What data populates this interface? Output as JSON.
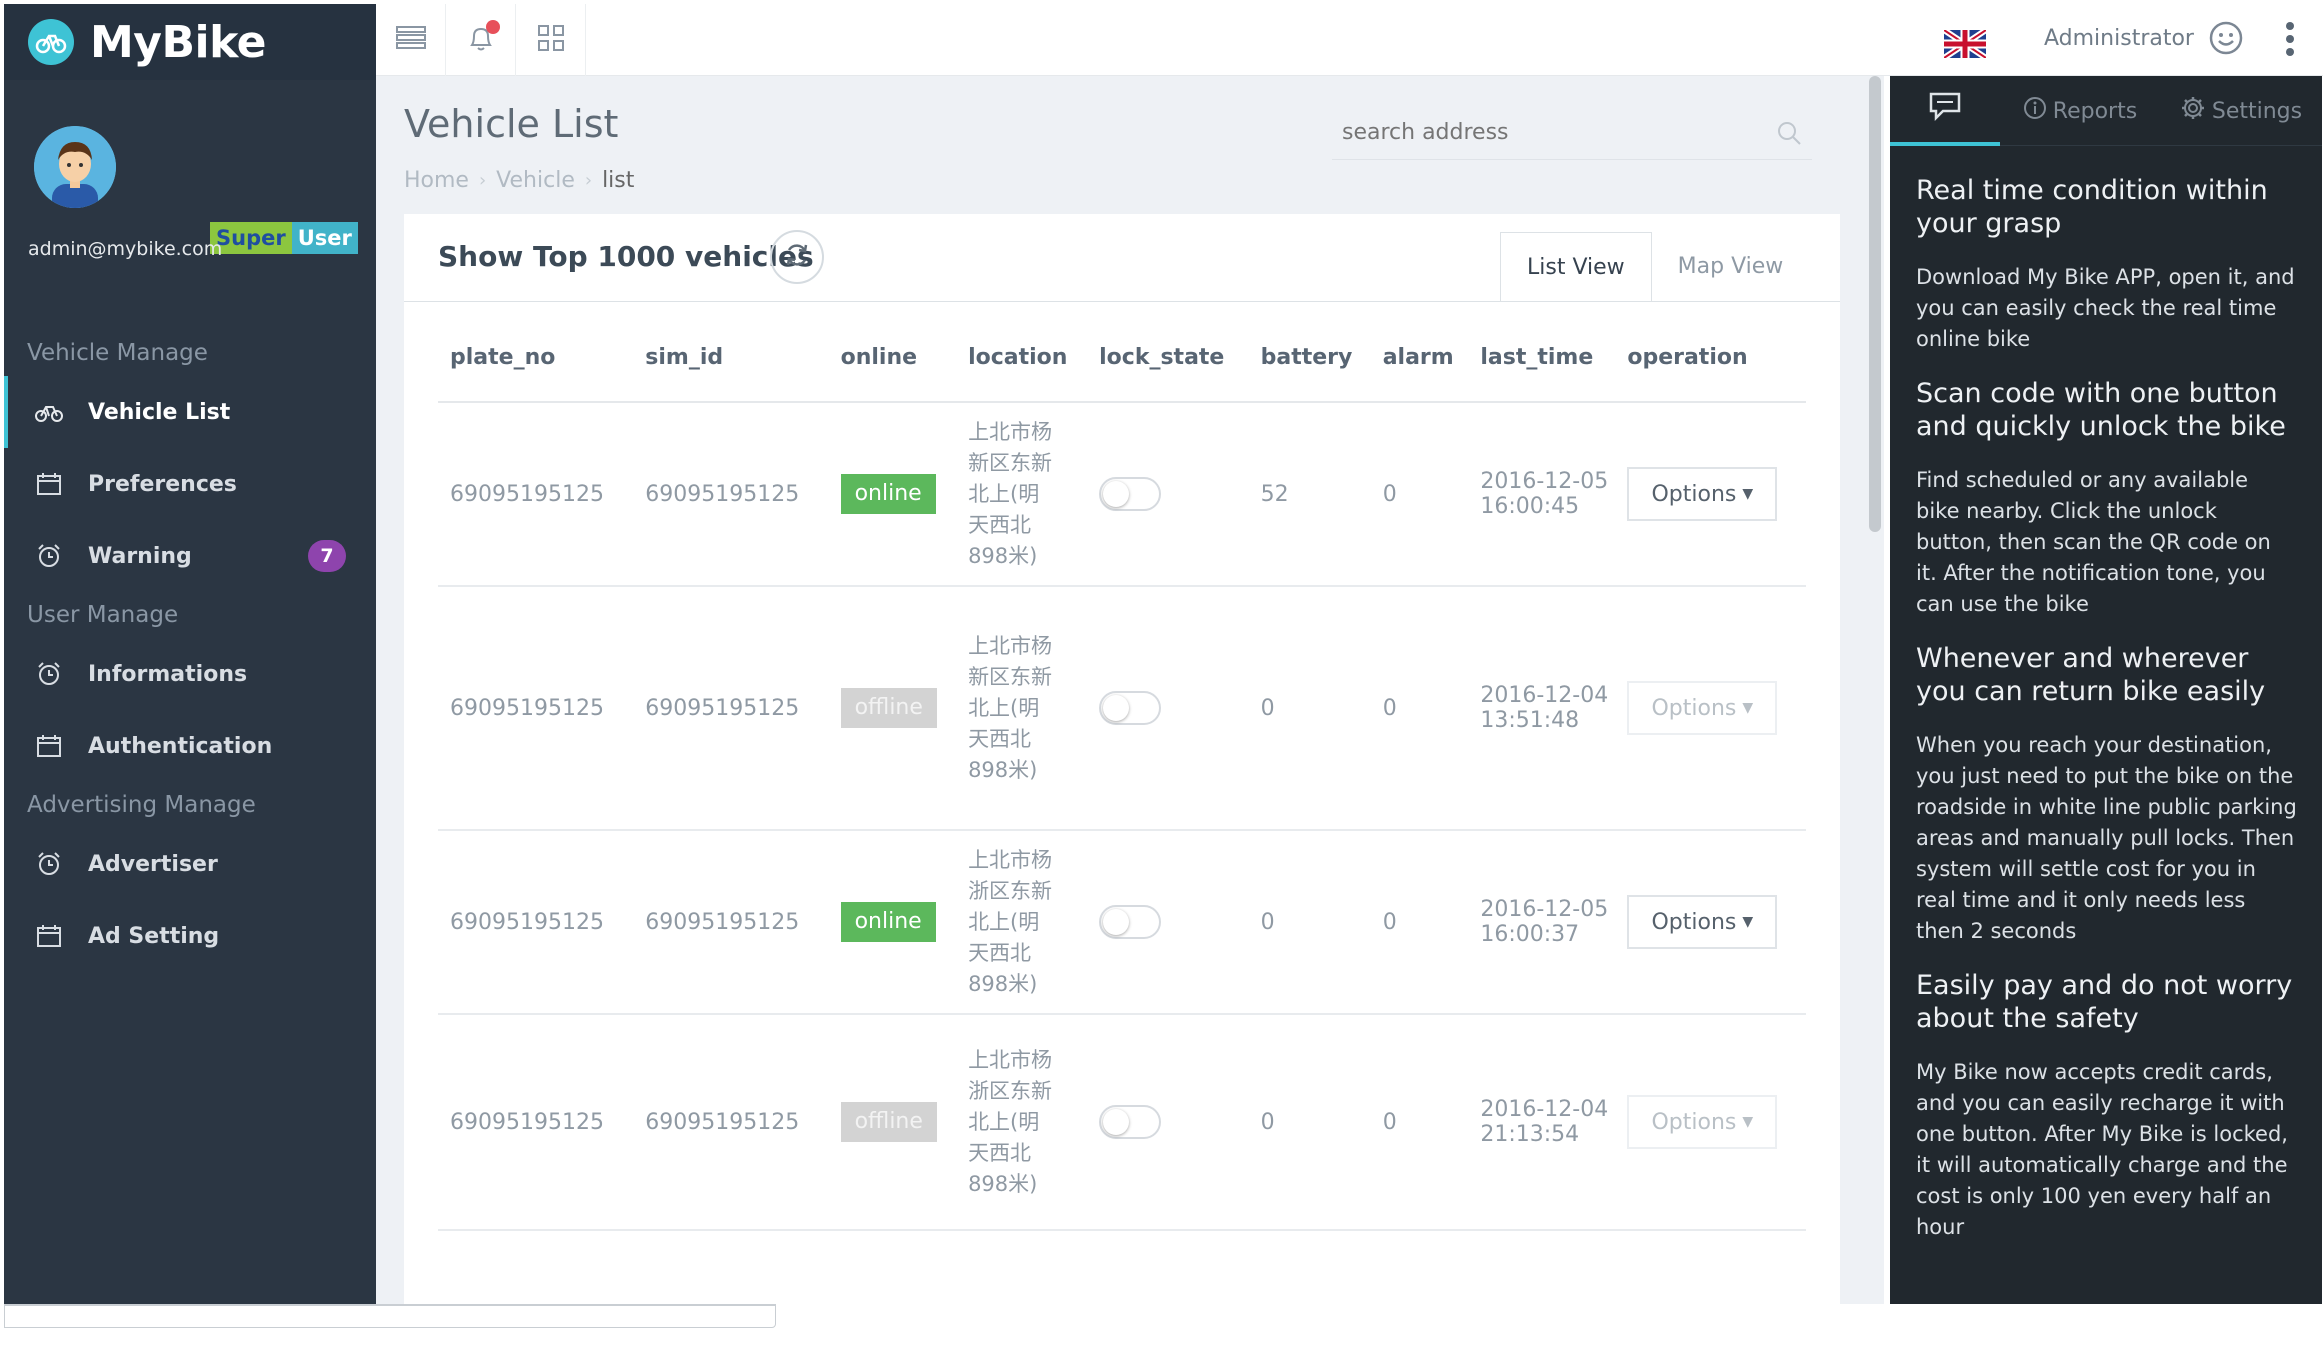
{
  "app": {
    "name": "MyBike"
  },
  "profile": {
    "role_part1": "Super",
    "role_part2": "User",
    "email": "admin@mybike.com"
  },
  "nav": {
    "group_vehicle": "Vehicle Manage",
    "group_user": "User Manage",
    "group_ads": "Advertising Manage",
    "items": [
      {
        "label": "Vehicle List"
      },
      {
        "label": "Preferences"
      },
      {
        "label": "Warning",
        "badge": "7"
      },
      {
        "label": "Informations"
      },
      {
        "label": "Authentication"
      },
      {
        "label": "Advertiser"
      },
      {
        "label": "Ad Setting"
      }
    ]
  },
  "topbar": {
    "user": "Administrator",
    "language_flag": "uk-flag-icon"
  },
  "page": {
    "title": "Vehicle List",
    "search_placeholder": "search address",
    "breadcrumb": [
      "Home",
      "Vehicle",
      "list"
    ]
  },
  "panel": {
    "title": "Show Top 1000 vehicles",
    "tab_list": "List View",
    "tab_map": "Map View"
  },
  "table": {
    "headers": [
      "plate_no",
      "sim_id",
      "online",
      "location",
      "lock_state",
      "battery",
      "alarm",
      "last_time",
      "operation"
    ],
    "option_label": "Options",
    "rows": [
      {
        "plate_no": "69095195125",
        "sim_id": "69095195125",
        "online": "online",
        "location": "上北市杨新区东新北上(明天西北898米)",
        "battery": "52",
        "alarm": "0",
        "time_date": "2016-12-05",
        "time_clock": "16:00:45"
      },
      {
        "plate_no": "69095195125",
        "sim_id": "69095195125",
        "online": "offline",
        "location": "上北市杨新区东新北上(明天西北898米)",
        "battery": "0",
        "alarm": "0",
        "time_date": "2016-12-04",
        "time_clock": "13:51:48"
      },
      {
        "plate_no": "69095195125",
        "sim_id": "69095195125",
        "online": "online",
        "location": "上北市杨浙区东新北上(明天西北898米)",
        "battery": "0",
        "alarm": "0",
        "time_date": "2016-12-05",
        "time_clock": "16:00:37"
      },
      {
        "plate_no": "69095195125",
        "sim_id": "69095195125",
        "online": "offline",
        "location": "上北市杨浙区东新北上(明天西北898米)",
        "battery": "0",
        "alarm": "0",
        "time_date": "2016-12-04",
        "time_clock": "21:13:54"
      }
    ]
  },
  "quick": {
    "tab_reports": "Reports",
    "tab_settings": "Settings",
    "sections": [
      {
        "heading": "Real time condition within your grasp",
        "text": "Download My Bike APP, open it, and you can easily check the real time online bike"
      },
      {
        "heading": "Scan code with one button and quickly unlock the bike",
        "text": "Find scheduled or any available bike nearby. Click the unlock button, then scan the QR code on it. After the notification tone, you can use the bike"
      },
      {
        "heading": "Whenever and wherever you can return bike easily",
        "text": "When you reach your destination, you just need to put the bike on the roadside in white line public parking areas and manually pull locks. Then system will settle cost for you in real time and it only needs less then 2 seconds"
      },
      {
        "heading": "Easily pay and do not worry about the safety",
        "text": "My Bike now accepts credit cards, and you can easily recharge it with one button. After My Bike is locked, it will automatically charge and the cost is only 100 yen every half an hour"
      }
    ]
  },
  "colors": {
    "sidebar": "#2b3643",
    "accent": "#3ec3d5",
    "online": "#5cb85c",
    "offline": "#d3d3d3",
    "badge": "#8e44ad"
  }
}
